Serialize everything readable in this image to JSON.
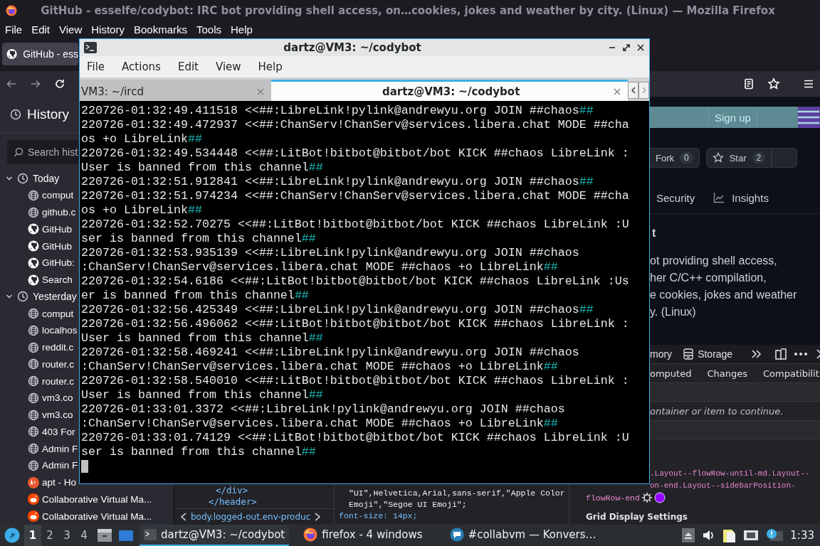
{
  "firefox": {
    "title": "GitHub - esselfe/codybot: IRC bot providing shell access, on…cookies, jokes and weather by city. (Linux) — Mozilla Firefox",
    "menu": [
      "File",
      "Edit",
      "View",
      "History",
      "Bookmarks",
      "Tools",
      "Help"
    ],
    "tabs": [
      {
        "label": "GitHub - ess",
        "selected": true
      }
    ],
    "sidebar": {
      "title": "History",
      "placeholder": "Search hist",
      "groups": [
        {
          "label": "Today",
          "expanded": true,
          "children": [
            {
              "label": "comput",
              "kind": "globe"
            },
            {
              "label": "github.c",
              "kind": "globe"
            },
            {
              "label": "GitHub",
              "kind": "github"
            },
            {
              "label": "GitHub",
              "kind": "github"
            },
            {
              "label": "GitHub:",
              "kind": "github"
            },
            {
              "label": "Search",
              "kind": "github"
            }
          ]
        },
        {
          "label": "Yesterday",
          "expanded": true,
          "children": [
            {
              "label": "comput",
              "kind": "globe"
            },
            {
              "label": "localhos",
              "kind": "globe"
            },
            {
              "label": "reddit.c",
              "kind": "globe"
            },
            {
              "label": "router.c",
              "kind": "globe"
            },
            {
              "label": "router.c",
              "kind": "globe"
            },
            {
              "label": "vm3.co",
              "kind": "globe"
            },
            {
              "label": "vm3.co",
              "kind": "globe"
            },
            {
              "label": "403 For",
              "kind": "globe"
            },
            {
              "label": "Admin F",
              "kind": "globe"
            },
            {
              "label": "Admin F",
              "kind": "globe"
            },
            {
              "label": "apt - Ho",
              "kind": "ask"
            },
            {
              "label": "Collaborative Virtual Ma...",
              "kind": "reddit"
            },
            {
              "label": "Collaborative Virtual Ma...",
              "kind": "reddit"
            }
          ]
        }
      ]
    },
    "page": {
      "sign_up": "Sign up",
      "fork": {
        "label": "Fork",
        "count": "0"
      },
      "star": {
        "label": "Star",
        "count": "2"
      },
      "nav_tabs": [
        {
          "label": "Security",
          "kind": "plain"
        },
        {
          "label": "Insights",
          "kind": "graph"
        }
      ],
      "heading": "t",
      "description": [
        "ot providing shell access,",
        "her C/C++ compilation,",
        "e cookies, jokes and weather",
        "y. (Linux)"
      ]
    },
    "devtools": {
      "tabs": [
        {
          "label": "mory",
          "kind": "plain"
        },
        {
          "label": "Storage",
          "kind": "storage"
        }
      ],
      "markup": [
        "</div>",
        "</header>"
      ],
      "breadcrumb": "body.logged-out.env-produc",
      "rules": [
        "\"UI\",Helvetica,Arial,sans-serif,\"Apple Color",
        "Emoji\",\"Segoe UI Emoji\";",
        "font-size: 14px;"
      ],
      "layout_tabs": [
        {
          "label": "omputed",
          "selected": false
        },
        {
          "label": "Changes",
          "selected": false
        },
        {
          "label": "Compatibilit",
          "selected": false
        }
      ],
      "notice": "ontainer or item to continue.",
      "selector_lines": [
        ".Layout--flowRow-until-md.Layout--",
        "on-end.Layout--sidebarPosition-"
      ],
      "selector_end": "flowRow-end",
      "grid_heading": "Grid Display Settings"
    }
  },
  "terminal": {
    "title": "dartz@VM3: ~/codybot",
    "menu": [
      "File",
      "Actions",
      "Edit",
      "View",
      "Help"
    ],
    "tabs": [
      {
        "label": "VM3: ~/ircd",
        "selected": false
      },
      {
        "label": "dartz@VM3: ~/codybot",
        "selected": true
      }
    ],
    "lines": [
      {
        "text": "220726-01:32:49.411518 <<##:LibreLink!pylink@andrewyu.org JOIN ##chaos",
        "tail": "##"
      },
      {
        "text": "220726-01:32:49.472937 <<##:ChanServ!ChanServ@services.libera.chat MODE ##cha"
      },
      {
        "text": "os +o LibreLink",
        "tail": "##"
      },
      {
        "text": "220726-01:32:49.534448 <<##:LitBot!bitbot@bitbot/bot KICK ##chaos LibreLink :"
      },
      {
        "text": "User is banned from this channel",
        "tail": "##"
      },
      {
        "text": "220726-01:32:51.912841 <<##:LibreLink!pylink@andrewyu.org JOIN ##chaos",
        "tail": "##"
      },
      {
        "text": "220726-01:32:51.974234 <<##:ChanServ!ChanServ@services.libera.chat MODE ##cha"
      },
      {
        "text": "os +o LibreLink",
        "tail": "##"
      },
      {
        "text": "220726-01:32:52.70275 <<##:LitBot!bitbot@bitbot/bot KICK ##chaos LibreLink :U"
      },
      {
        "text": "ser is banned from this channel",
        "tail": "##"
      },
      {
        "text": "220726-01:32:53.935139 <<##:LibreLink!pylink@andrewyu.org JOIN ##chaos"
      },
      {
        "text": ":ChanServ!ChanServ@services.libera.chat MODE ##chaos +o LibreLink",
        "tail": "##"
      },
      {
        "text": "220726-01:32:54.6186 <<##:LitBot!bitbot@bitbot/bot KICK ##chaos LibreLink :Us"
      },
      {
        "text": "er is banned from this channel",
        "tail": "##"
      },
      {
        "text": "220726-01:32:56.425349 <<##:LibreLink!pylink@andrewyu.org JOIN ##chaos",
        "tail": "##"
      },
      {
        "text": "220726-01:32:56.496062 <<##:LitBot!bitbot@bitbot/bot KICK ##chaos LibreLink :"
      },
      {
        "text": "User is banned from this channel",
        "tail": "##"
      },
      {
        "text": "220726-01:32:58.469241 <<##:LibreLink!pylink@andrewyu.org JOIN ##chaos"
      },
      {
        "text": ":ChanServ!ChanServ@services.libera.chat MODE ##chaos +o LibreLink",
        "tail": "##"
      },
      {
        "text": "220726-01:32:58.540010 <<##:LitBot!bitbot@bitbot/bot KICK ##chaos LibreLink :"
      },
      {
        "text": "User is banned from this channel",
        "tail": "##"
      },
      {
        "text": "220726-01:33:01.3372 <<##:LibreLink!pylink@andrewyu.org JOIN ##chaos"
      },
      {
        "text": ":ChanServ!ChanServ@services.libera.chat MODE ##chaos +o LibreLink",
        "tail": "##"
      },
      {
        "text": "220726-01:33:01.74129 <<##:LitBot!bitbot@bitbot/bot KICK ##chaos LibreLink :U"
      },
      {
        "text": "ser is banned from this channel",
        "tail": "##"
      }
    ],
    "cursor": true
  },
  "taskbar": {
    "workspaces": [
      {
        "label": "1",
        "selected": true
      },
      {
        "label": "2",
        "selected": false
      },
      {
        "label": "3",
        "selected": false
      },
      {
        "label": "4",
        "selected": false
      }
    ],
    "tasks": [
      {
        "label": "dartz@VM3: ~/codybot",
        "kind": "terminal",
        "selected": true
      },
      {
        "label": "firefox - 4 windows",
        "kind": "firefox",
        "selected": false
      },
      {
        "label": "#collabvm — Konvers…",
        "kind": "chat",
        "selected": false
      }
    ],
    "clock": "1:33"
  }
}
